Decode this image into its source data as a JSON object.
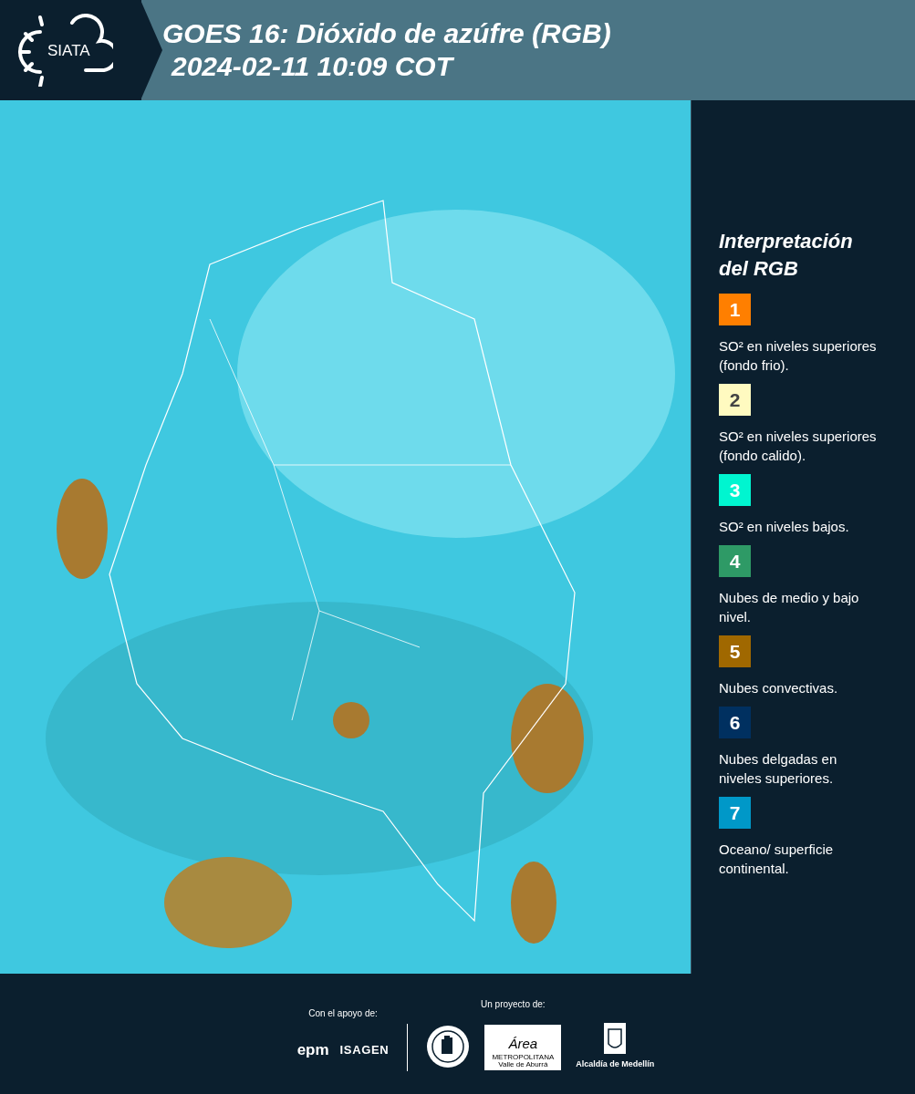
{
  "header": {
    "logo_text": "SIATA",
    "title": "GOES 16: Dióxido de azúfre (RGB)",
    "subtitle": "2024-02-11 10:09 COT"
  },
  "legend": {
    "title": "Interpretación del RGB",
    "items": [
      {
        "number": "1",
        "color": "#ff7f00",
        "label": "SO² en niveles superiores (fondo frio)."
      },
      {
        "number": "2",
        "color": "#fffac0",
        "label": "SO² en niveles superiores (fondo calido)."
      },
      {
        "number": "3",
        "color": "#00f5d0",
        "label": "SO² en niveles bajos."
      },
      {
        "number": "4",
        "color": "#2e9a66",
        "label": "Nubes de medio y bajo nivel."
      },
      {
        "number": "5",
        "color": "#a06800",
        "label": "Nubes convectivas."
      },
      {
        "number": "6",
        "color": "#003060",
        "label": "Nubes delgadas en niveles superiores."
      },
      {
        "number": "7",
        "color": "#0098c8",
        "label": "Oceano/ superficie continental."
      }
    ]
  },
  "footer": {
    "support_label": "Con el apoyo de:",
    "sponsors": [
      "epm",
      "ISAGEN"
    ],
    "project_label": "Un proyecto de:",
    "area_logo": {
      "name": "Área",
      "line1": "METROPOLITANA",
      "line2": "Valle de Aburrá"
    },
    "city_logo_text": "Alcaldía de Medellín"
  }
}
